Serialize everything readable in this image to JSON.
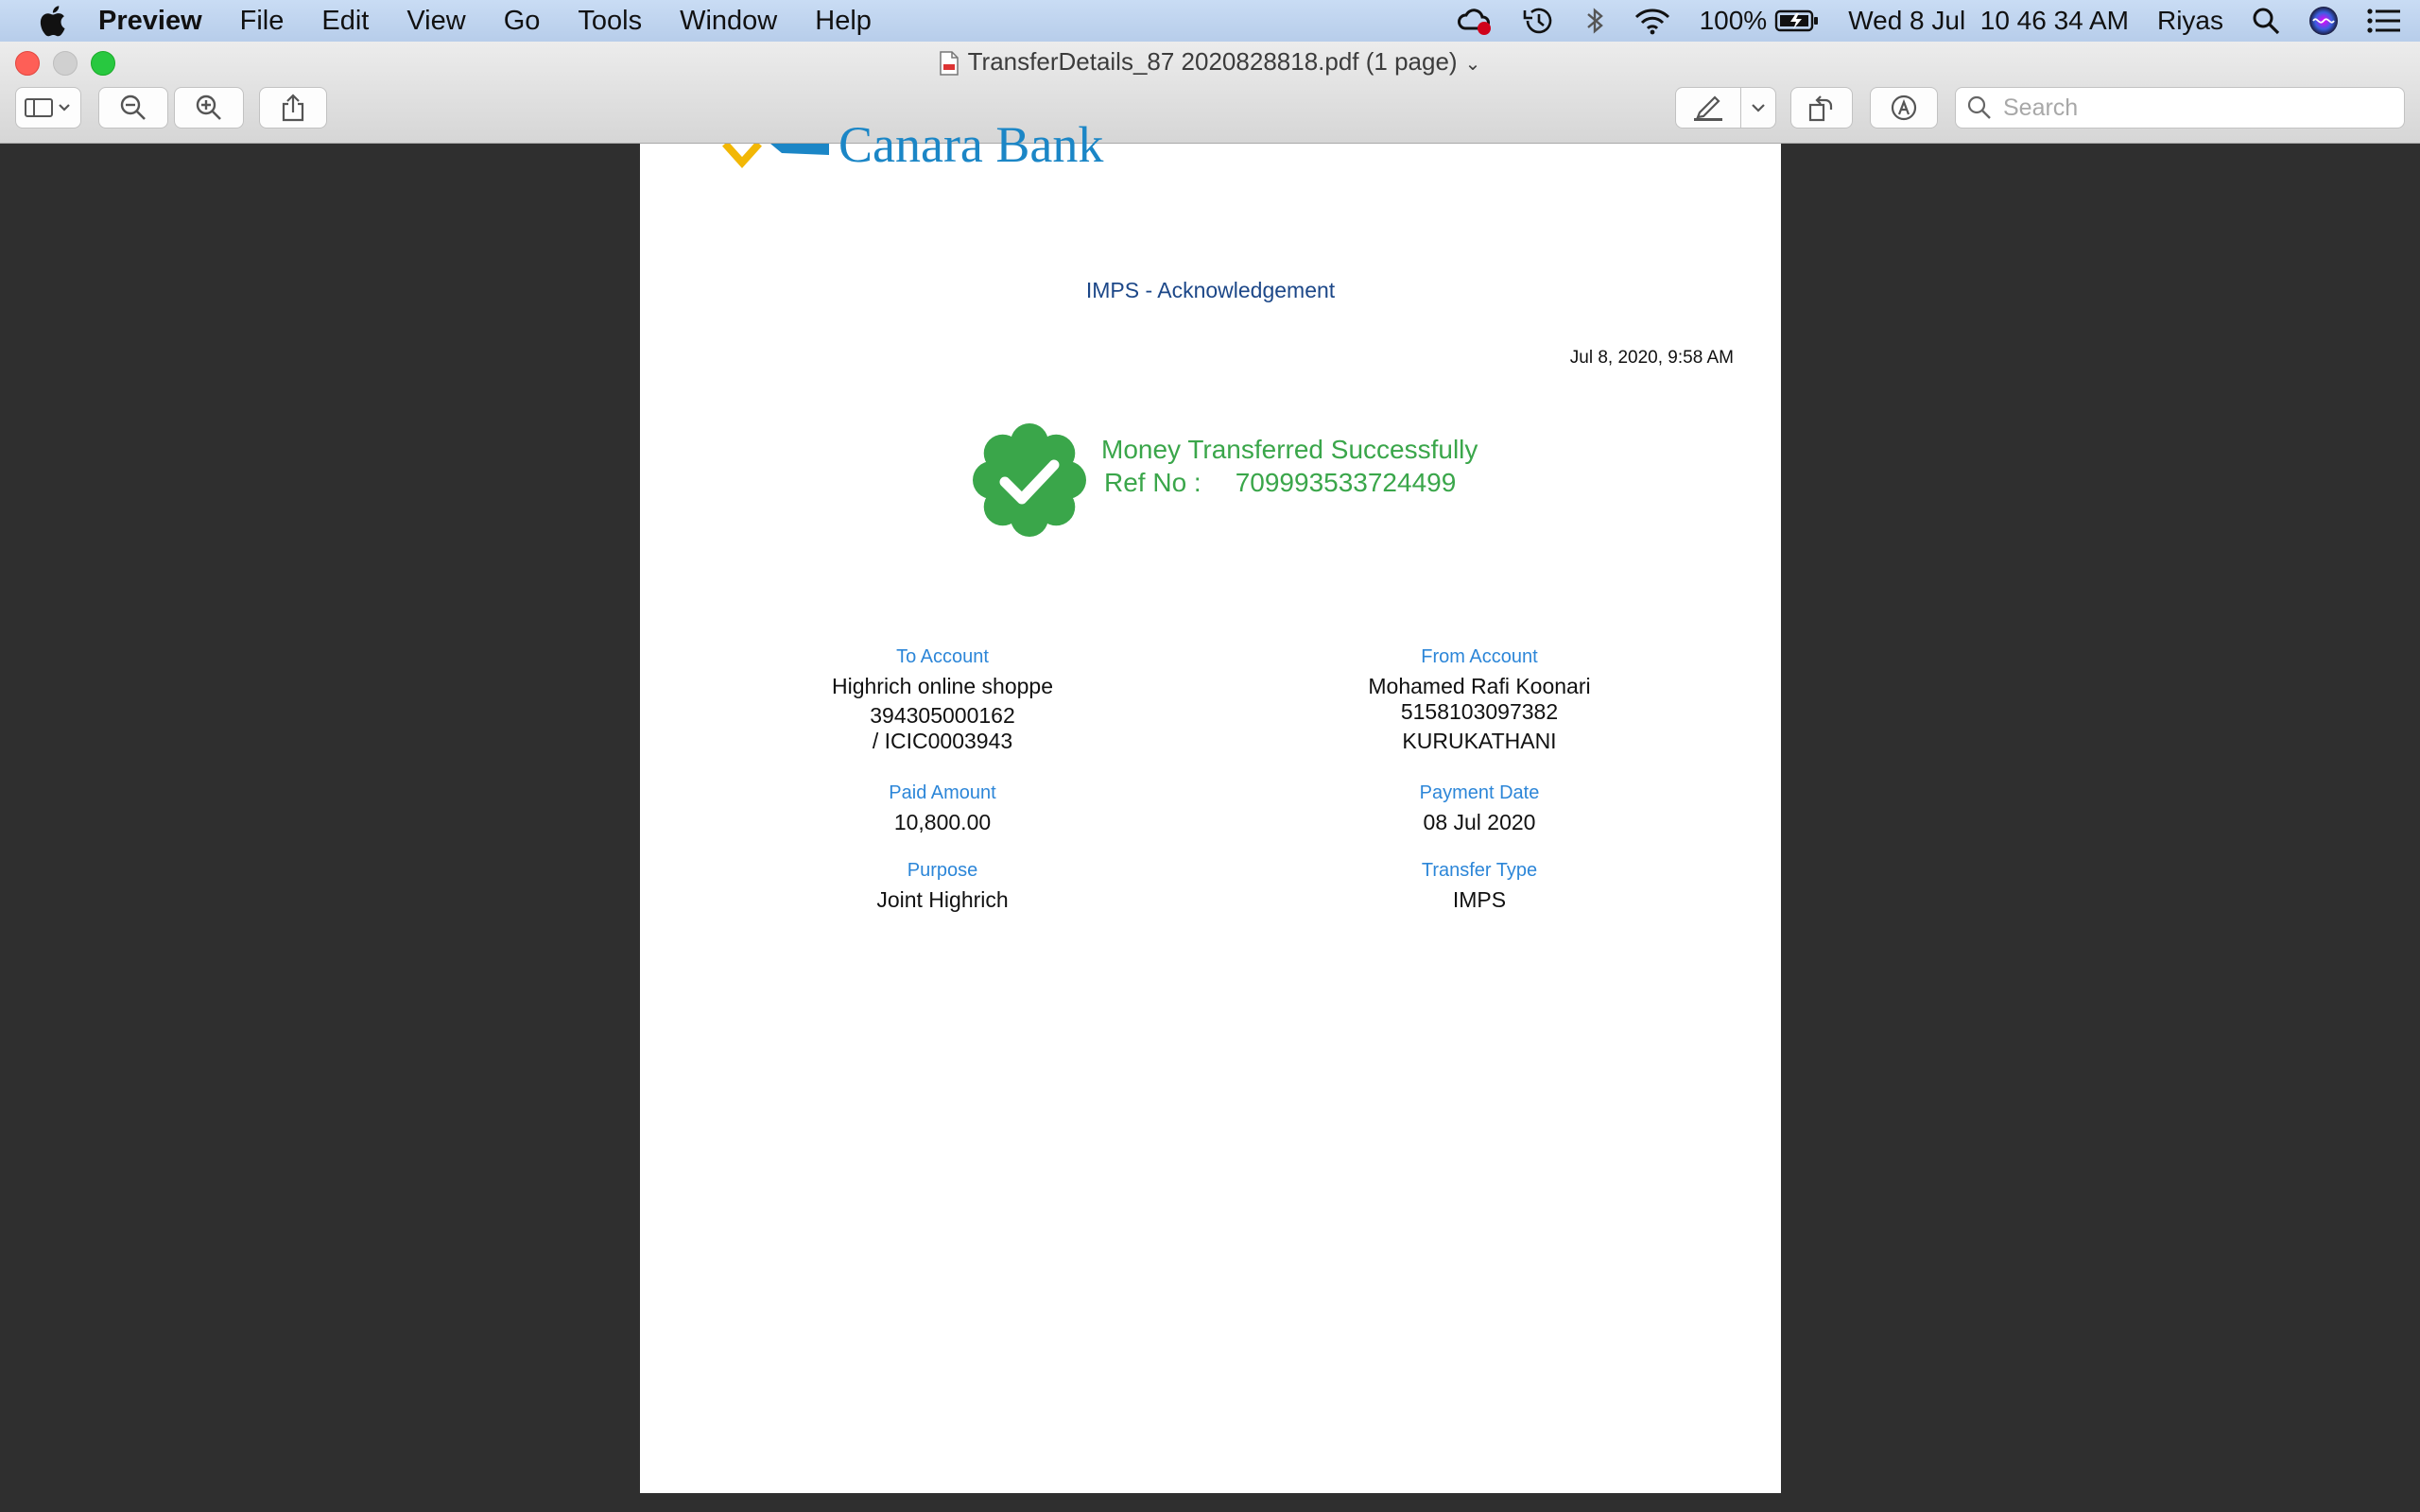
{
  "menubar": {
    "app_name": "Preview",
    "menus": [
      "File",
      "Edit",
      "View",
      "Go",
      "Tools",
      "Window",
      "Help"
    ],
    "battery": "100%",
    "clock": "Wed 8 Jul  10 46 34 AM",
    "user": "Riyas"
  },
  "window": {
    "title": "TransferDetails_87 2020828818.pdf (1 page)",
    "search_placeholder": "Search"
  },
  "document": {
    "logo_text": "Canara Bank",
    "title": "IMPS - Acknowledgement",
    "timestamp": "Jul 8, 2020, 9:58 AM",
    "success_message": "Money Transferred Successfully",
    "ref_label": "Ref No :",
    "ref_number": "709993533724499",
    "to_account": {
      "label": "To Account",
      "name": "Highrich online shoppe",
      "number": "394305000162",
      "ifsc": "/ ICIC0003943"
    },
    "from_account": {
      "label": "From Account",
      "name": "Mohamed Rafi Koonari",
      "number": "5158103097382",
      "branch": "KURUKATHANI"
    },
    "paid_amount": {
      "label": "Paid Amount",
      "value": "10,800.00"
    },
    "payment_date": {
      "label": "Payment Date",
      "value": "08 Jul 2020"
    },
    "purpose": {
      "label": "Purpose",
      "value": "Joint Highrich"
    },
    "transfer_type": {
      "label": "Transfer Type",
      "value": "IMPS"
    }
  },
  "colors": {
    "success_green": "#3aa64a",
    "label_blue": "#2c86d8",
    "title_navy": "#1c4788",
    "canvas_dark": "#2f2f2f"
  }
}
